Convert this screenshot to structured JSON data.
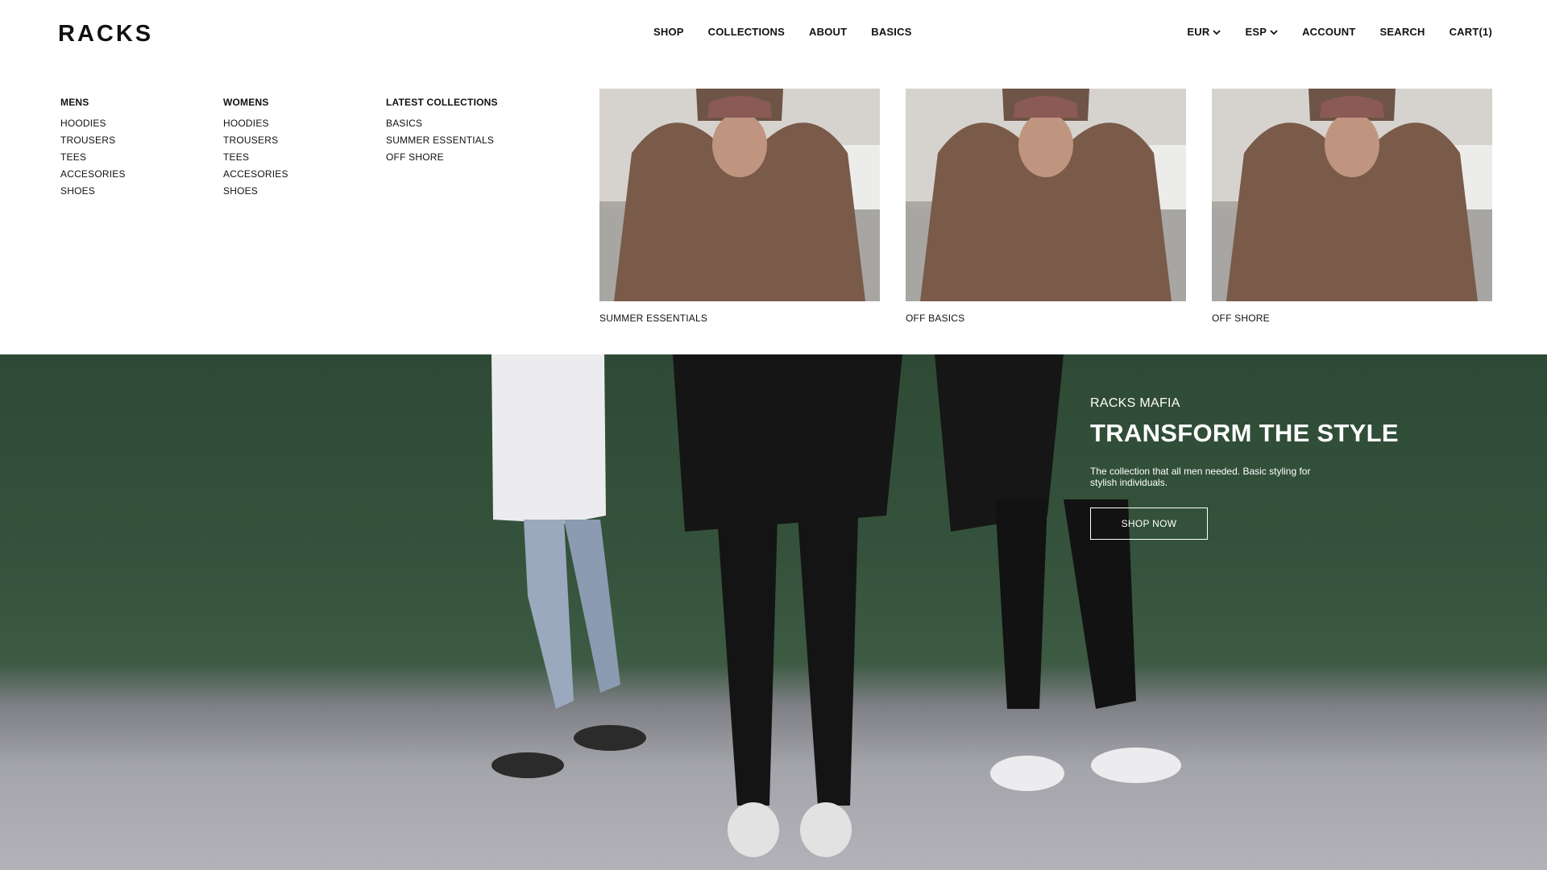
{
  "header": {
    "logo": "RACKS",
    "nav": [
      "SHOP",
      "COLLECTIONS",
      "ABOUT",
      "BASICS"
    ],
    "currency": "EUR",
    "language": "ESP",
    "account": "ACCOUNT",
    "search": "SEARCH",
    "cart": "CART(1)"
  },
  "mega_menu": {
    "mens": {
      "title": "MENS",
      "items": [
        "HOODIES",
        "TROUSERS",
        "TEES",
        "ACCESORIES",
        "SHOES"
      ]
    },
    "womens": {
      "title": "WOMENS",
      "items": [
        "HOODIES",
        "TROUSERS",
        "TEES",
        "ACCESORIES",
        "SHOES"
      ]
    },
    "latest": {
      "title": "LATEST COLLECTIONS",
      "items": [
        "BASICS",
        "SUMMER ESSENTIALS",
        "OFF SHORE"
      ]
    },
    "cards": [
      {
        "caption": "SUMMER ESSENTIALS"
      },
      {
        "caption": "OFF BASICS"
      },
      {
        "caption": "OFF SHORE"
      }
    ]
  },
  "hero": {
    "eyebrow": "RACKS MAFIA",
    "headline": "TRANSFORM THE STYLE",
    "description": "The collection that all men needed. Basic styling for stylish individuals.",
    "cta": "SHOP NOW"
  }
}
